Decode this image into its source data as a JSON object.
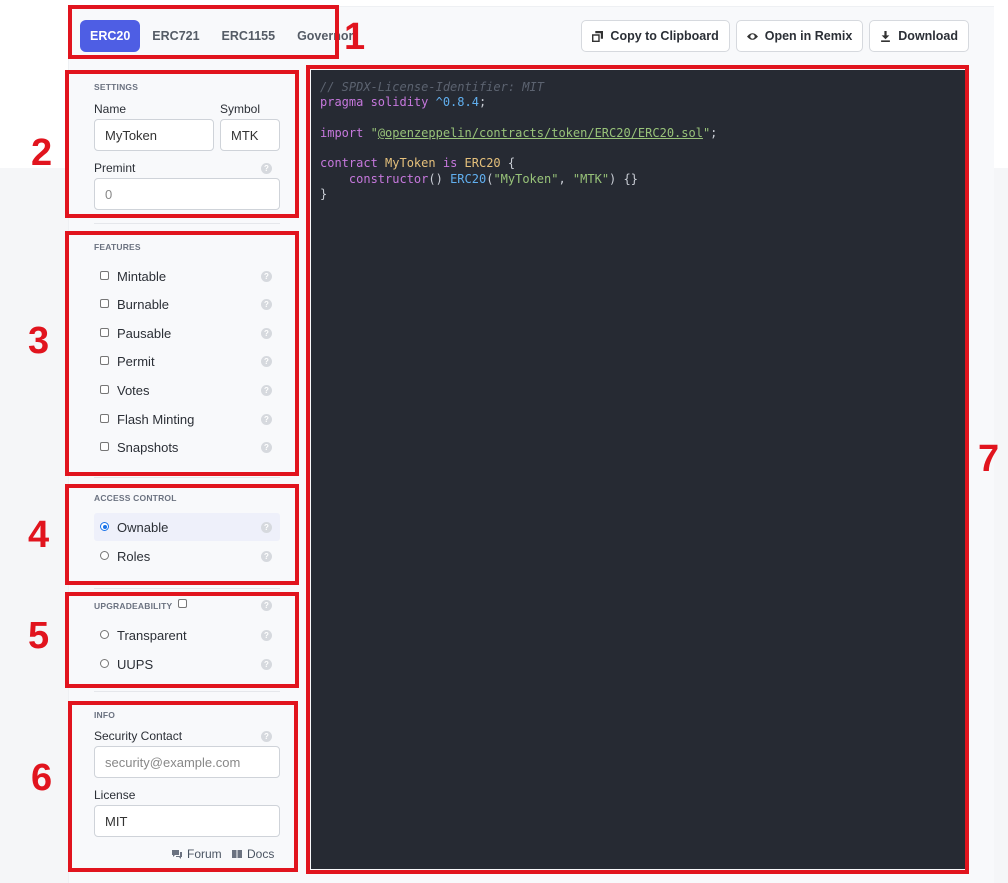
{
  "tabs": [
    "ERC20",
    "ERC721",
    "ERC1155",
    "Governor"
  ],
  "toolbar": {
    "copy_label": "Copy to Clipboard",
    "remix_label": "Open in Remix",
    "download_label": "Download"
  },
  "settings": {
    "heading": "SETTINGS",
    "name_label": "Name",
    "name_value": "MyToken",
    "symbol_label": "Symbol",
    "symbol_value": "MTK",
    "premint_label": "Premint",
    "premint_placeholder": "0"
  },
  "features": {
    "heading": "FEATURES",
    "items": [
      "Mintable",
      "Burnable",
      "Pausable",
      "Permit",
      "Votes",
      "Flash Minting",
      "Snapshots"
    ]
  },
  "access_control": {
    "heading": "ACCESS CONTROL",
    "options": [
      "Ownable",
      "Roles"
    ],
    "selected": "Ownable"
  },
  "upgradeability": {
    "heading": "UPGRADEABILITY",
    "options": [
      "Transparent",
      "UUPS"
    ]
  },
  "info": {
    "heading": "INFO",
    "security_label": "Security Contact",
    "security_placeholder": "security@example.com",
    "license_label": "License",
    "license_value": "MIT",
    "forum_label": "Forum",
    "docs_label": "Docs"
  },
  "code": {
    "comment": "// SPDX-License-Identifier: MIT",
    "pragma_kw": "pragma solidity",
    "pragma_ver": "^0.8.4",
    "import_kw": "import",
    "import_path": "@openzeppelin/contracts/token/ERC20/ERC20.sol",
    "contract_kw": "contract",
    "contract_name": "MyToken",
    "is_kw": "is",
    "base": "ERC20",
    "ctor_kw": "constructor",
    "ctor_base": "ERC20",
    "arg1": "\"MyToken\"",
    "arg2": "\"MTK\""
  },
  "annotations": [
    "1",
    "2",
    "3",
    "4",
    "5",
    "6",
    "7"
  ],
  "colors": {
    "accent": "#4e5ee4",
    "annotation": "#e1141e",
    "code_bg": "#262a33"
  }
}
